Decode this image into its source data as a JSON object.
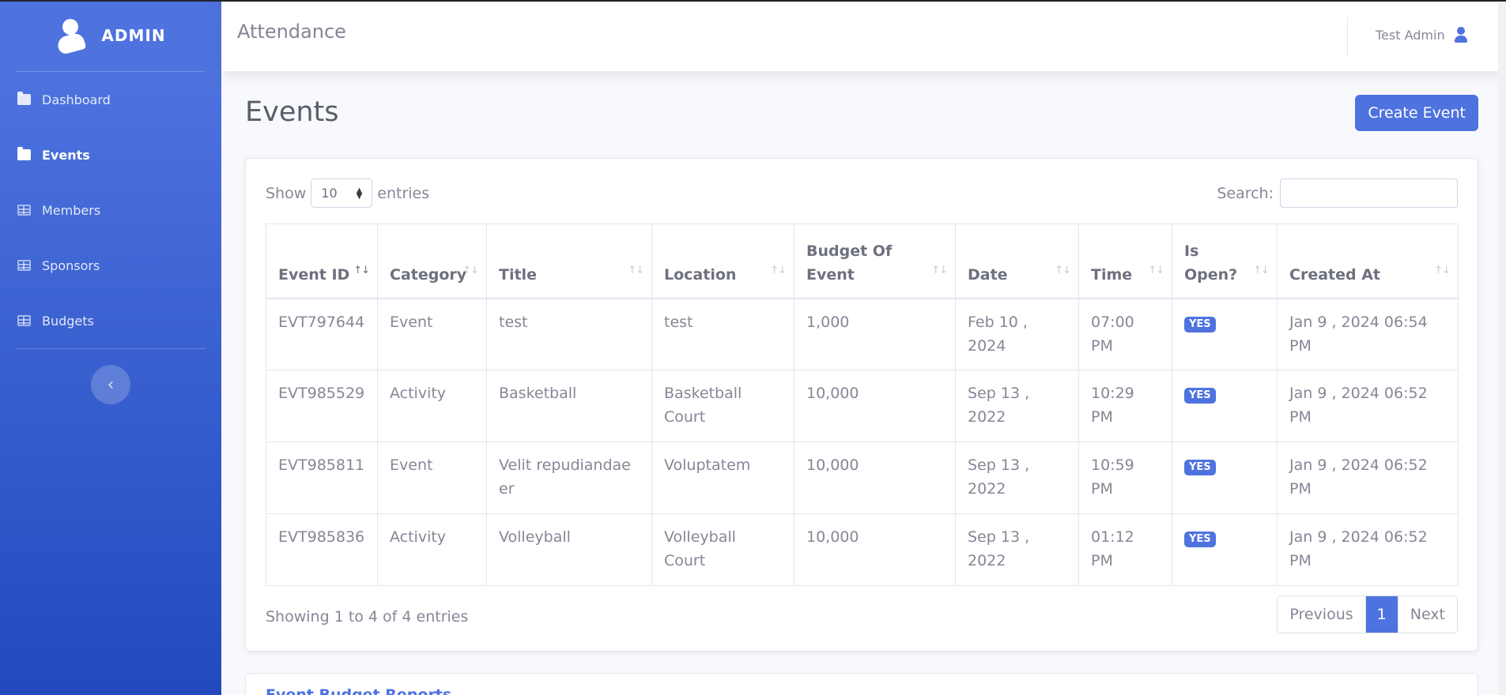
{
  "sidebar": {
    "brand": "ADMIN",
    "items": [
      {
        "label": "Dashboard",
        "icon": "folder-icon"
      },
      {
        "label": "Events",
        "icon": "folder-icon"
      },
      {
        "label": "Members",
        "icon": "table-icon"
      },
      {
        "label": "Sponsors",
        "icon": "table-icon"
      },
      {
        "label": "Budgets",
        "icon": "table-icon"
      }
    ],
    "active": "Events",
    "toggle_icon": "chevron-left-icon"
  },
  "topbar": {
    "title": "Attendance",
    "user_name": "Test Admin"
  },
  "page": {
    "title": "Events",
    "create_label": "Create Event"
  },
  "table_controls": {
    "show_label": "Show",
    "entries_value": "10",
    "entries_label": "entries",
    "search_label": "Search:",
    "search_value": ""
  },
  "table": {
    "columns": [
      "Event ID",
      "Category",
      "Title",
      "Location",
      "Budget Of Event",
      "Date",
      "Time",
      "Is Open?",
      "Created At"
    ],
    "rows": [
      [
        "EVT797644",
        "Event",
        "test",
        "test",
        "1,000",
        "Feb 10 , 2024",
        "07:00 PM",
        "YES",
        "Jan 9 , 2024 06:54 PM"
      ],
      [
        "EVT985529",
        "Activity",
        "Basketball",
        "Basketball Court",
        "10,000",
        "Sep 13 , 2022",
        "10:29 PM",
        "YES",
        "Jan 9 , 2024 06:52 PM"
      ],
      [
        "EVT985811",
        "Event",
        "Velit repudiandaeer",
        "Voluptatem",
        "10,000",
        "Sep 13 , 2022",
        "10:59 PM",
        "YES",
        "Jan 9 , 2024 06:52 PM"
      ],
      [
        "EVT985836",
        "Activity",
        "Volleyball",
        "Volleyball Court",
        "10,000",
        "Sep 13 , 2022",
        "01:12 PM",
        "YES",
        "Jan 9 , 2024 06:52 PM"
      ]
    ]
  },
  "footer": {
    "info": "Showing 1 to 4 of 4 entries",
    "previous": "Previous",
    "page": "1",
    "next": "Next"
  },
  "next_card": {
    "title": "Event Budget Reports"
  },
  "colors": {
    "primary": "#4e73df",
    "sidebar_bottom": "#224abe",
    "text_muted": "#858796"
  }
}
